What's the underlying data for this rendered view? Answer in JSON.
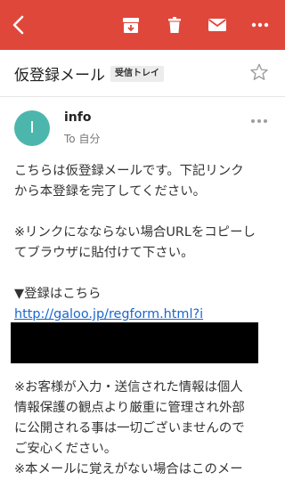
{
  "toolbar": {
    "color": "#e0473b",
    "icons": [
      "back-arrow-icon",
      "archive-icon",
      "trash-icon",
      "mail-icon",
      "more-icon"
    ]
  },
  "email": {
    "subject": "仮登録メール",
    "label": "受信トレイ",
    "sender_initial": "I",
    "sender": "info",
    "recipient": "To 自分",
    "avatar_color": "#4db6ac",
    "body": {
      "intro_lines": [
        "こちらは仮登録メールです。下記リンク",
        "から本登録を完了してください。"
      ],
      "note_lines": [
        "※リンクになならない場合URLをコピーし",
        "てブラウザに貼付けて下さい。"
      ],
      "register_heading": "▼登録はこちら",
      "register_link": "http://galoo.jp/regform.html?i",
      "privacy_lines": [
        "※お客様が入力・送信された情報は個人",
        "情報保護の観点より厳重に管理され外部",
        "に公開される事は一切ございませんので",
        "ご安心ください。"
      ],
      "closing_line": "※本メールに覚えがない場合はこのメー"
    }
  }
}
